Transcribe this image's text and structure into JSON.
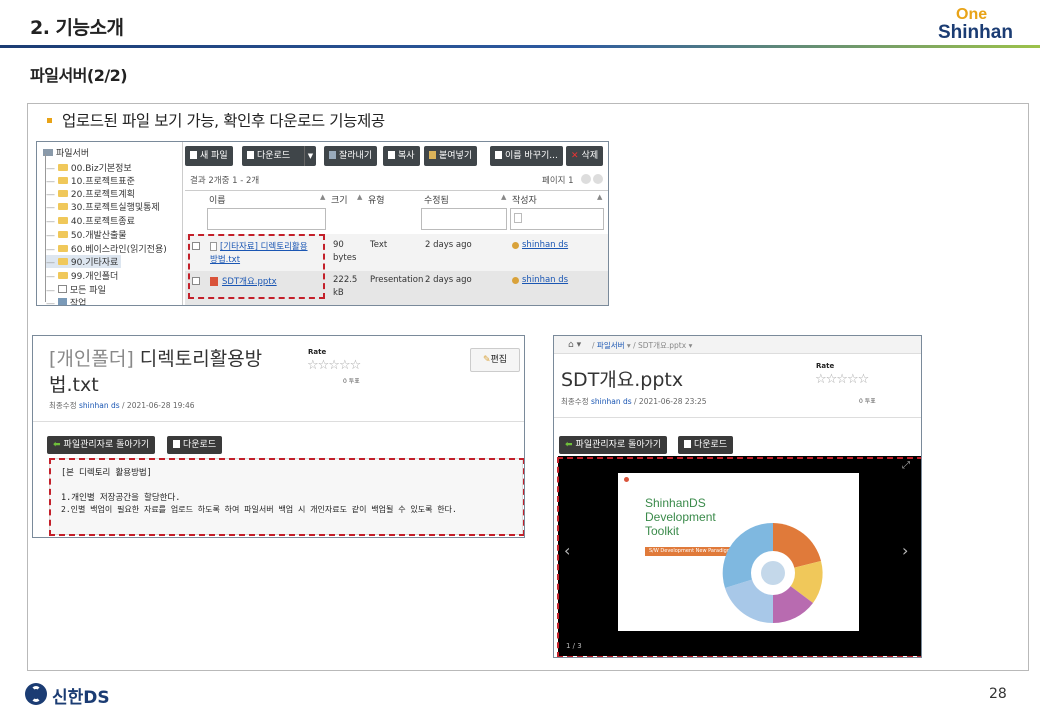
{
  "header": {
    "title": "2. 기능소개",
    "logo_one": "One",
    "logo_shinhan": "Shinhan"
  },
  "subtitle": "파일서버(2/2)",
  "bullet": "업로드된 파일 보기 가능, 확인후 다운로드 기능제공",
  "file_browser": {
    "tree_root": "파일서버",
    "tree": [
      "00.Biz기본정보",
      "10.프로젝트표준",
      "20.프로젝트계획",
      "30.프로젝트실행및통제",
      "40.프로젝트종료",
      "50.개발산출물",
      "60.베이스라인(읽기전용)",
      "90.기타자료",
      "99.개인폴더",
      "모든 파일",
      "작업"
    ],
    "toolbar": {
      "new_file": "새 파일",
      "download": "다운로드",
      "cut": "잘라내기",
      "copy": "복사",
      "paste": "붙여넣기",
      "rename": "이름 바꾸기...",
      "delete": "삭제"
    },
    "result_text": "결과 2개중 1 - 2개",
    "page_label": "페이지 1",
    "columns": {
      "name": "이름",
      "size": "크기",
      "type": "유형",
      "modified": "수정됨",
      "author": "작성자"
    },
    "rows": [
      {
        "name_l1": "[기타자료] 디렉토리활용",
        "name_l2": "방법.txt",
        "size_l1": "90",
        "size_l2": "bytes",
        "type": "Text",
        "modified": "2 days ago",
        "author": "shinhan ds"
      },
      {
        "name_l1": "SDT개요.pptx",
        "size_l1": "222.5",
        "size_l2": "kB",
        "type": "Presentation",
        "modified": "2 days ago",
        "author": "shinhan ds"
      }
    ]
  },
  "doc_view": {
    "title_bracket": "[개인폴더]",
    "title_rest": " 디렉토리활용방",
    "title_l2": "법.txt",
    "rate": "Rate",
    "rate_sub": "0 투표",
    "edit": "편집",
    "meta_prefix": "최종수정 ",
    "meta_user": "shinhan ds",
    "meta_date": " / 2021-06-28 19:46",
    "back_btn": "파일관리자로 돌아가기",
    "download_btn": "다운로드",
    "content": [
      "[본 디렉토리 활용방법]",
      "",
      "1.개인별 저장공간을 할당한다.",
      "2.인별 백업이 필요한 자료를 업로드 하도록 하여 파일서버 백업 시 개인자료도 같이 백업될 수 있도록 한다."
    ]
  },
  "pptx_view": {
    "breadcrumb": [
      "파일서버",
      "SDT개요.pptx"
    ],
    "title": "SDT개요.pptx",
    "rate": "Rate",
    "rate_sub": "0 투표",
    "meta_prefix": "최종수정 ",
    "meta_user": "shinhan ds",
    "meta_date": " / 2021-06-28 23:25",
    "back_btn": "파일관리자로 돌아가기",
    "download_btn": "다운로드",
    "slide_title_l1": "ShinhanDS",
    "slide_title_l2": "Development",
    "slide_title_l3": "Toolkit",
    "slide_sub": "S/W Development New Paradigm",
    "counter": "1 / 3",
    "prev": "‹",
    "next": "›"
  },
  "footer": {
    "logo_text": "신한DS",
    "page": "28"
  }
}
